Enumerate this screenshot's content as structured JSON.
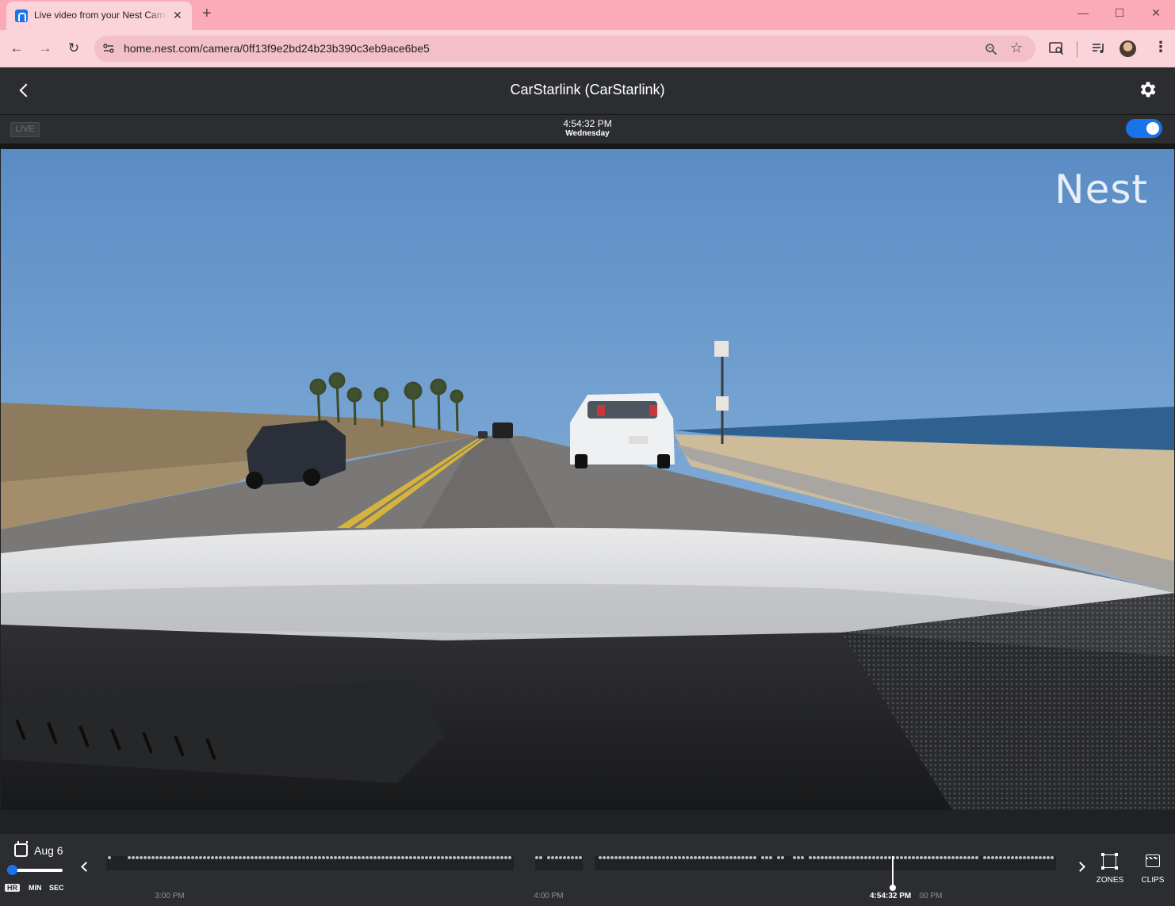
{
  "browser": {
    "tab_title": "Live video from your Nest Camera",
    "url": "home.nest.com/camera/0ff13f9e2bd24b23b390c3eb9ace6be5",
    "colors": {
      "tabstrip": "#fbaab8",
      "toolbar": "#fbd3da"
    }
  },
  "camera": {
    "title": "CarStarlink (CarStarlink)",
    "live_label": "LIVE",
    "time": "4:54:32 PM",
    "day": "Wednesday",
    "power_on": true,
    "watermark": "Nest"
  },
  "timeline": {
    "date": "Aug 6",
    "scale_options": [
      "HR",
      "MIN",
      "SEC"
    ],
    "active_scale": "HR",
    "ticks": [
      "3:00 PM",
      "4:00 PM",
      "00 PM"
    ],
    "playhead_label": "4:54:32 PM",
    "zones_label": "ZONES",
    "clips_label": "CLIPS"
  },
  "colors": {
    "accent": "#1a73e8",
    "app_bg": "#2b2d31"
  },
  "icons": [
    "back-arrow-icon",
    "forward-arrow-icon",
    "reload-icon",
    "site-info-icon",
    "zoom-icon",
    "star-icon",
    "cast-icon",
    "media-icon",
    "profile-avatar",
    "kebab-menu-icon",
    "settings-gear-icon",
    "calendar-icon",
    "zones-icon",
    "clips-icon"
  ]
}
